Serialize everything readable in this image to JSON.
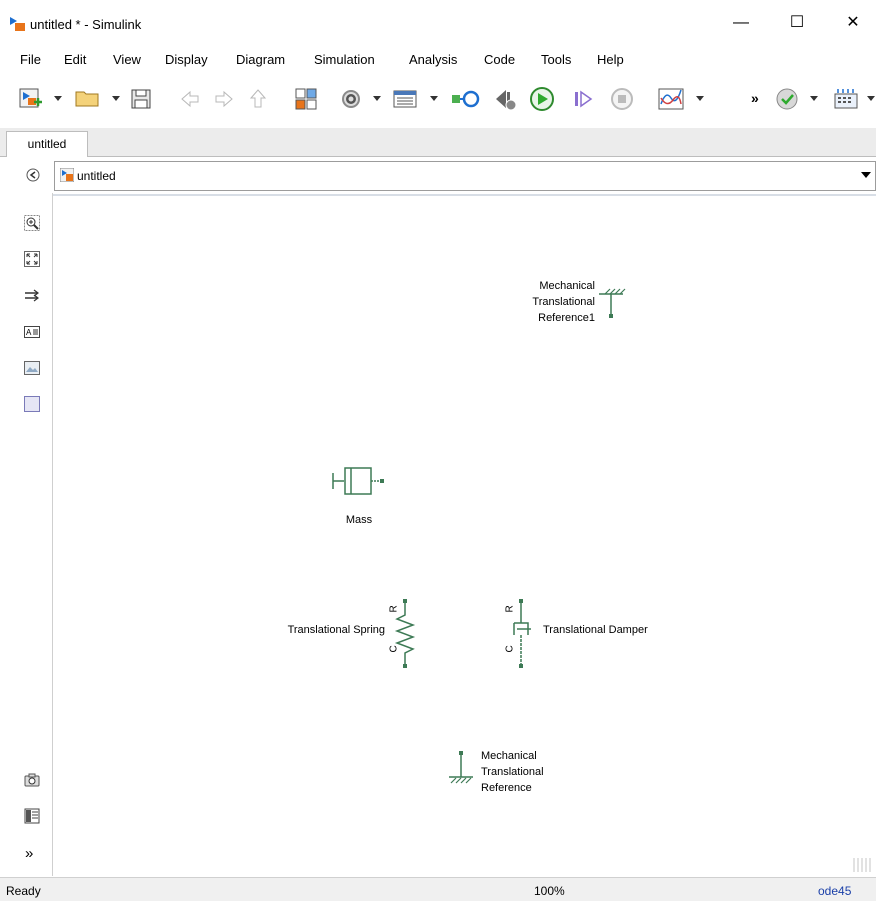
{
  "window": {
    "title": "untitled * - Simulink"
  },
  "menu": [
    "File",
    "Edit",
    "View",
    "Display",
    "Diagram",
    "Simulation",
    "Analysis",
    "Code",
    "Tools",
    "Help"
  ],
  "toolbar": {
    "overflow": "»"
  },
  "tabs": [
    {
      "label": "untitled"
    }
  ],
  "explorer": {
    "path": "untitled"
  },
  "blocks": {
    "ref1": [
      "Mechanical",
      "Translational",
      "Reference1"
    ],
    "mass": "Mass",
    "spring": "Translational Spring",
    "spring_port_r": "R",
    "spring_port_c": "C",
    "damper": "Translational Damper",
    "damper_port_r": "R",
    "damper_port_c": "C",
    "ref": [
      "Mechanical",
      "Translational",
      "Reference"
    ]
  },
  "palette": {
    "more": "»"
  },
  "status": {
    "state": "Ready",
    "zoom": "100%",
    "solver": "ode45"
  },
  "colors": {
    "block": "#3d7a55",
    "accent_green": "#2eaa2e"
  }
}
